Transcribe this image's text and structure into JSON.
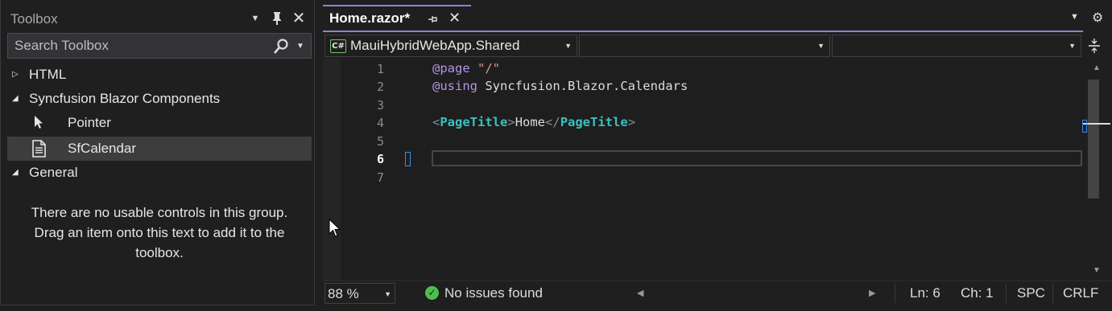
{
  "toolbox": {
    "title": "Toolbox",
    "search_placeholder": "Search Toolbox",
    "groups": [
      {
        "label": "HTML",
        "expanded": false
      },
      {
        "label": "Syncfusion Blazor Components",
        "expanded": true,
        "items": [
          {
            "label": "Pointer",
            "icon": "pointer-icon"
          },
          {
            "label": "SfCalendar",
            "icon": "component-icon",
            "selected": true
          }
        ]
      },
      {
        "label": "General",
        "expanded": true
      }
    ],
    "empty_message_line1": "There are no usable controls in this group.",
    "empty_message_line2": "Drag an item onto this text to add it to the",
    "empty_message_line3": "toolbox."
  },
  "editor": {
    "tab_label": "Home.razor*",
    "nav": {
      "project": "MauiHybridWebApp.Shared",
      "project_icon_text": "C#",
      "type": "",
      "member": ""
    },
    "line_numbers": [
      "1",
      "2",
      "3",
      "4",
      "5",
      "6",
      "7"
    ],
    "active_line": "6",
    "code": {
      "l1_kw": "@page",
      "l1_str": "\"/\"",
      "l2_kw": "@using",
      "l2_rest": "Syncfusion.Blazor.Calendars",
      "l4_open_lt": "<",
      "l4_tag1": "PageTitle",
      "l4_open_gt": ">",
      "l4_text": "Home",
      "l4_close_lt": "</",
      "l4_tag2": "PageTitle",
      "l4_close_gt": ">"
    }
  },
  "status": {
    "zoom": "88 %",
    "issues": "No issues found",
    "line": "Ln: 6",
    "col": "Ch: 1",
    "whitespace": "SPC",
    "line_ending": "CRLF"
  },
  "colors": {
    "accent": "#9b7cd8",
    "tag": "#3bc1c1",
    "keyword": "#b394e8",
    "string": "#d69d85",
    "ok": "#4bbf4b"
  }
}
